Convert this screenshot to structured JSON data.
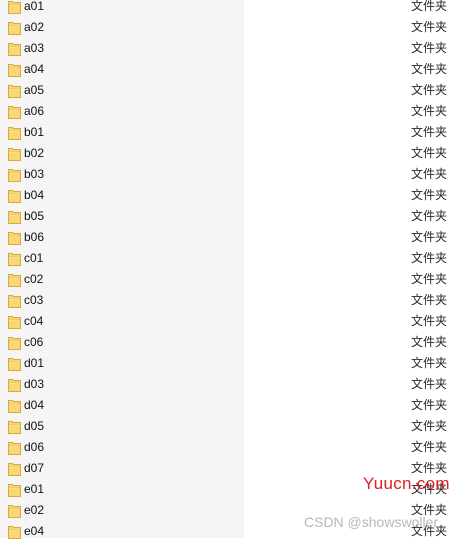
{
  "file_list": {
    "type_label": "文件夹",
    "items": [
      {
        "name": "a01"
      },
      {
        "name": "a02"
      },
      {
        "name": "a03"
      },
      {
        "name": "a04"
      },
      {
        "name": "a05"
      },
      {
        "name": "a06"
      },
      {
        "name": "b01"
      },
      {
        "name": "b02"
      },
      {
        "name": "b03"
      },
      {
        "name": "b04"
      },
      {
        "name": "b05"
      },
      {
        "name": "b06"
      },
      {
        "name": "c01"
      },
      {
        "name": "c02"
      },
      {
        "name": "c03"
      },
      {
        "name": "c04"
      },
      {
        "name": "c06"
      },
      {
        "name": "d01"
      },
      {
        "name": "d03"
      },
      {
        "name": "d04"
      },
      {
        "name": "d05"
      },
      {
        "name": "d06"
      },
      {
        "name": "d07"
      },
      {
        "name": "e01"
      },
      {
        "name": "e02"
      },
      {
        "name": "e04"
      }
    ]
  },
  "watermarks": {
    "site": "Yuucn.com",
    "author": "CSDN @showswoller"
  },
  "colors": {
    "name_column_bg": "#f5f5f5",
    "folder_fill": "#f8d775",
    "folder_edge": "#d9a93b",
    "watermark_red": "#e02020"
  },
  "icons": {
    "folder": "folder-icon"
  }
}
